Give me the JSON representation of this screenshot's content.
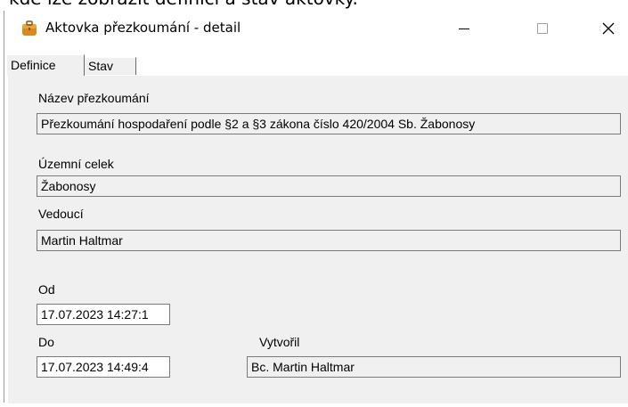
{
  "top_cropped_text": "kde lze zobrazit definici a stav aktovky.",
  "window": {
    "title": "Aktovka přezkoumání - detail",
    "controls": {
      "minimize": "—",
      "close": "✕"
    }
  },
  "tabs": [
    {
      "label": "Definice",
      "active": true
    },
    {
      "label": "Stav",
      "active": false
    }
  ],
  "form": {
    "nazev": {
      "label": "Název přezkoumání",
      "value": "Přezkoumání hospodaření podle §2 a §3 zákona číslo 420/2004 Sb. Žabonosy"
    },
    "uzemni": {
      "label": "Územní celek",
      "value": "Žabonosy"
    },
    "vedouci": {
      "label": "Vedoucí",
      "value": "Martin Haltmar"
    },
    "od": {
      "label": "Od",
      "value": "17.07.2023 14:27:1"
    },
    "do": {
      "label": "Do",
      "value": "17.07.2023 14:49:4"
    },
    "vytvoril": {
      "label": "Vytvořil",
      "value": "Bc. Martin Haltmar"
    }
  },
  "icons": {
    "app": "briefcase-icon"
  }
}
